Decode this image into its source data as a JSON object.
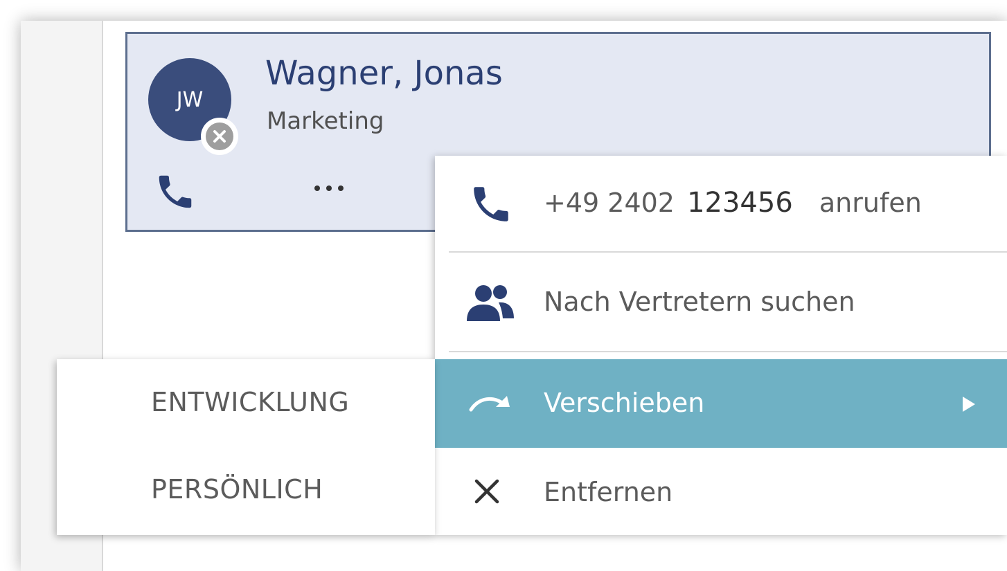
{
  "contact": {
    "initials": "JW",
    "name": "Wagner, Jonas",
    "department": "Marketing",
    "status_icon": "status-offline-x-icon"
  },
  "card_actions": {
    "phone_icon": "phone-icon",
    "more_icon": "more-dots-icon"
  },
  "context_menu": {
    "call": {
      "icon": "phone-icon",
      "number": "+49 2402",
      "number_bold": "123456",
      "action": "anrufen"
    },
    "find_deputies": {
      "icon": "people-icon",
      "label": "Nach Vertretern suchen"
    },
    "move": {
      "icon": "move-arrow-icon",
      "label": "Verschieben",
      "submenu_indicator": "triangle-right-icon"
    },
    "remove": {
      "icon": "close-icon",
      "label": "Entfernen"
    }
  },
  "submenu": {
    "items": [
      "ENTWICKLUNG",
      "PERSÖNLICH"
    ]
  },
  "colors": {
    "accent_dark_blue": "#2b3f73",
    "avatar_bg": "#3a4d7c",
    "card_bg": "#e4e8f3",
    "card_border": "#5c6e8e",
    "highlight": "#6fb1c4"
  }
}
